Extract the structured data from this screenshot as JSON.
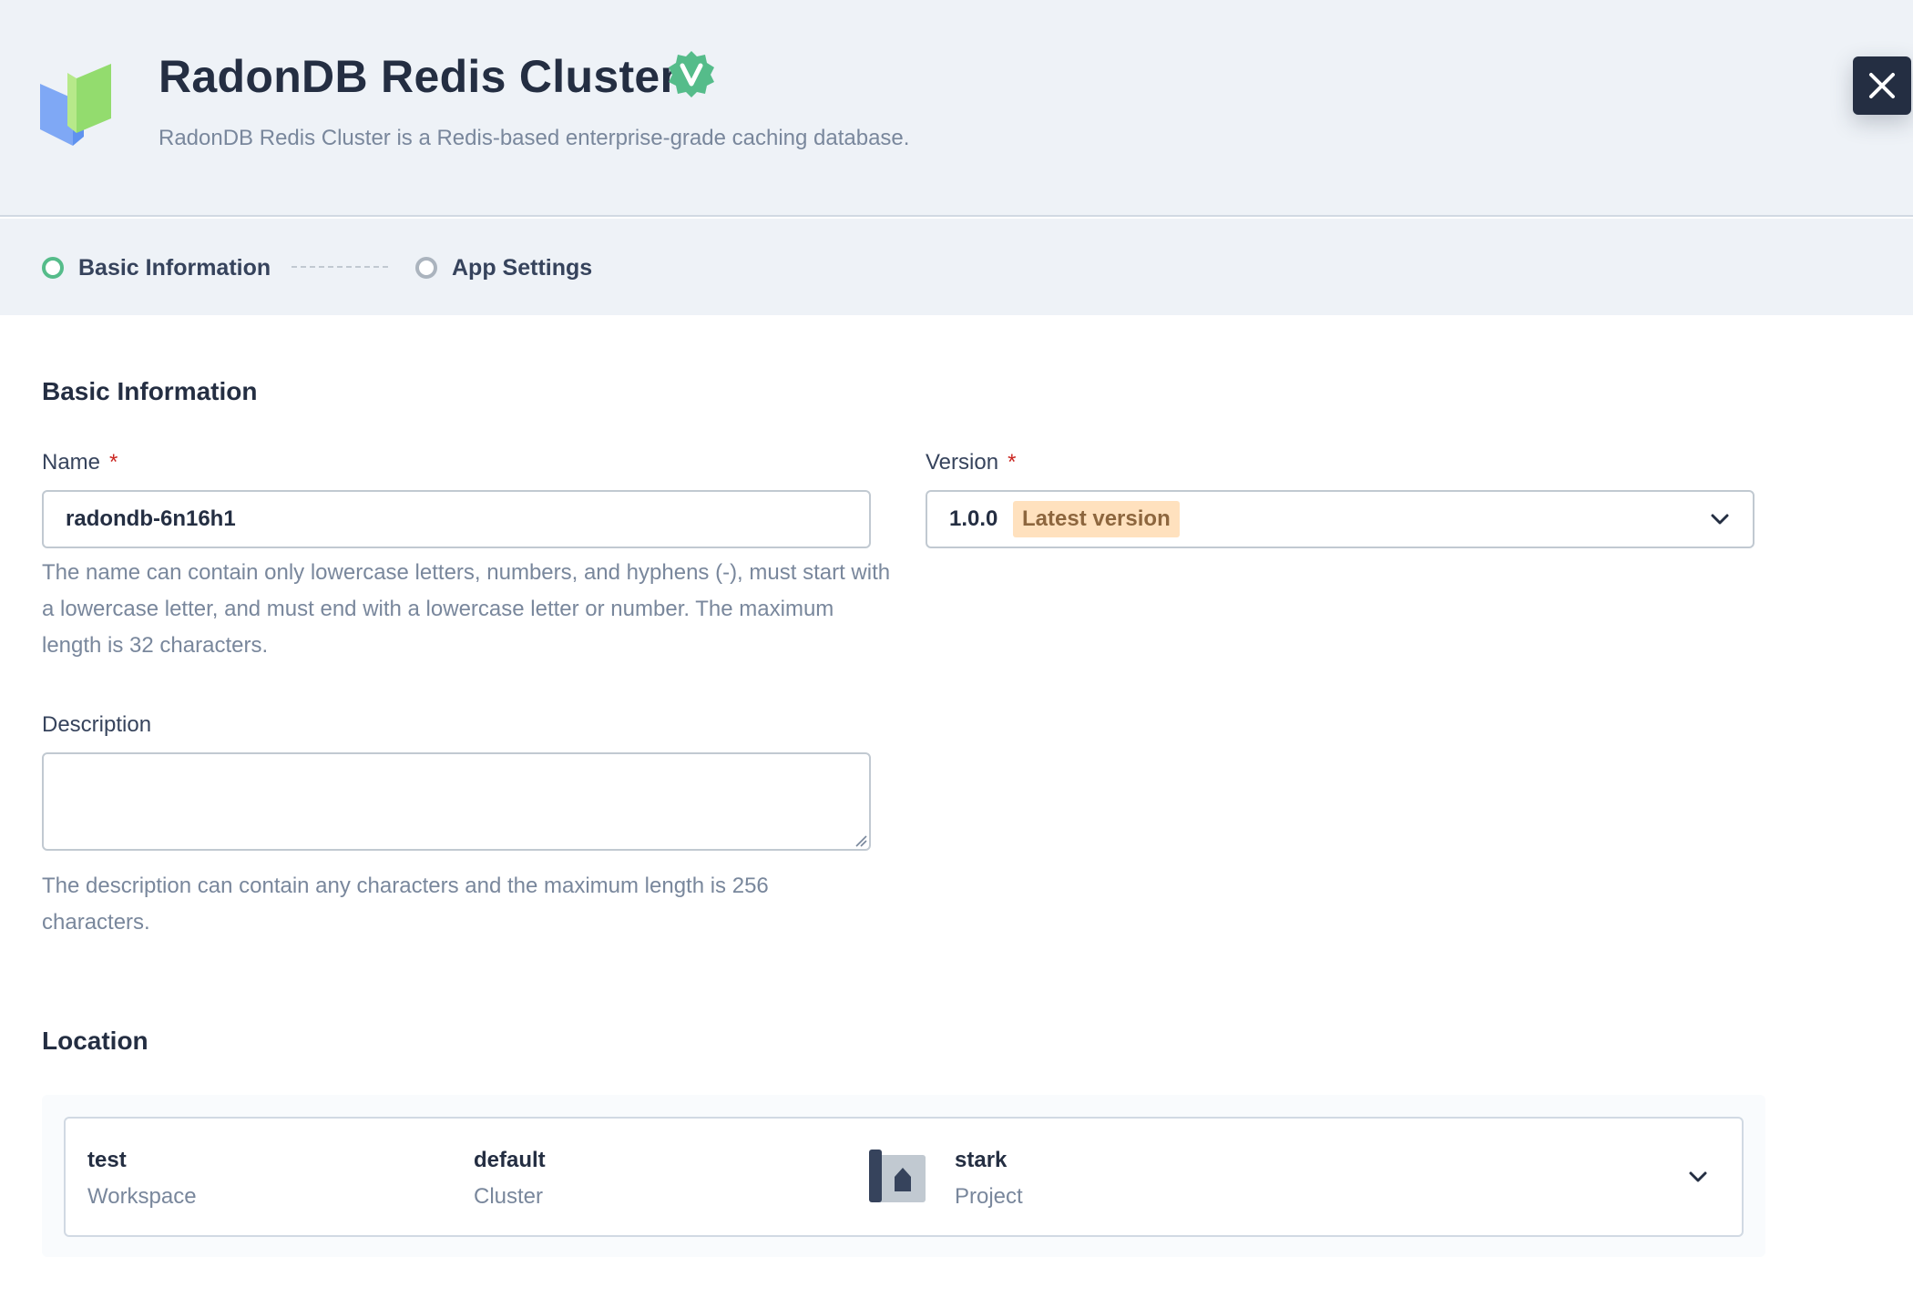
{
  "app": {
    "title": "RadonDB Redis Cluster",
    "description": "RadonDB Redis Cluster is a Redis-based enterprise-grade caching database.",
    "verified_icon": "verified-badge-icon",
    "close_icon": "close-icon"
  },
  "steps": [
    {
      "label": "Basic Information",
      "state": "active"
    },
    {
      "label": "App Settings",
      "state": "pending"
    }
  ],
  "basic": {
    "section_title": "Basic Information",
    "name": {
      "label": "Name",
      "required_mark": "*",
      "value": "radondb-6n16h1",
      "hint": "The name can contain only lowercase letters, numbers, and hyphens (-), must start with a lowercase letter, and must end with a lowercase letter or number. The maximum length is 32 characters."
    },
    "version": {
      "label": "Version",
      "required_mark": "*",
      "value": "1.0.0",
      "badge": "Latest version"
    },
    "description": {
      "label": "Description",
      "value": "",
      "hint": "The description can contain any characters and the maximum length is 256 characters."
    }
  },
  "location": {
    "section_title": "Location",
    "workspace": {
      "value": "test",
      "type": "Workspace"
    },
    "cluster": {
      "value": "default",
      "type": "Cluster"
    },
    "project": {
      "value": "stark",
      "type": "Project",
      "icon": "project-icon"
    }
  },
  "colors": {
    "accent_green": "#55bc8a",
    "dark": "#242e42",
    "badge_bg": "#ffe1be",
    "required_red": "#ca2621"
  }
}
